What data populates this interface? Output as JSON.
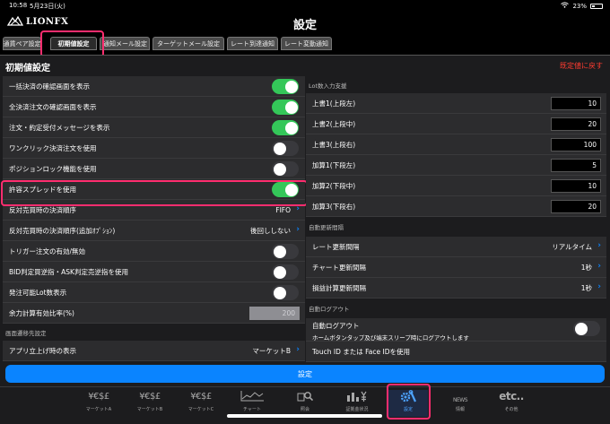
{
  "status_bar": {
    "time": "10:58",
    "date": "5月23日(火)",
    "battery": "23%"
  },
  "header": {
    "logo": "LIONFX",
    "title": "設定"
  },
  "tabs": [
    {
      "label": "通貨ペア設定",
      "active": false
    },
    {
      "label": "初期値設定",
      "active": true
    },
    {
      "label": "通知メール設定",
      "active": false
    },
    {
      "label": "ターゲットメール設定",
      "active": false
    },
    {
      "label": "レート到達通知",
      "active": false
    },
    {
      "label": "レート変動通知",
      "active": false
    }
  ],
  "section": {
    "title": "初期値設定",
    "reset": "既定値に戻す"
  },
  "left_rows": [
    {
      "label": "一括決済の確認画面を表示",
      "type": "toggle",
      "on": true
    },
    {
      "label": "全決済注文の確認画面を表示",
      "type": "toggle",
      "on": true
    },
    {
      "label": "注文・約定受付メッセージを表示",
      "type": "toggle",
      "on": true
    },
    {
      "label": "ワンクリック決済注文を使用",
      "type": "toggle",
      "on": false
    },
    {
      "label": "ポジションロック機能を使用",
      "type": "toggle",
      "on": false
    },
    {
      "label": "許容スプレッドを使用",
      "type": "toggle",
      "on": true
    },
    {
      "label": "反対売買時の決済順序",
      "type": "select",
      "value": "FIFO"
    },
    {
      "label": "反対売買時の決済順序(追加ｵﾌﾟｼｮﾝ)",
      "type": "select",
      "value": "後回ししない"
    },
    {
      "label": "トリガー注文の有効/無効",
      "type": "toggle",
      "on": false
    },
    {
      "label": "BID判定買逆指・ASK判定売逆指を使用",
      "type": "toggle",
      "on": false
    },
    {
      "label": "発注可能Lot数表示",
      "type": "toggle",
      "on": false
    },
    {
      "label": "余力計算有効比率(%)",
      "type": "number",
      "value": "200",
      "disabled": true
    }
  ],
  "left_group2": {
    "label": "画面遷移先設定",
    "rows": [
      {
        "label": "アプリ立上げ時の表示",
        "value": "マーケットB"
      }
    ]
  },
  "lot_group": {
    "label": "Lot数入力支援",
    "rows": [
      {
        "label": "上書1(上段左)",
        "value": "10"
      },
      {
        "label": "上書2(上段中)",
        "value": "20"
      },
      {
        "label": "上書3(上段右)",
        "value": "100"
      },
      {
        "label": "加算1(下段左)",
        "value": "5"
      },
      {
        "label": "加算2(下段中)",
        "value": "10"
      },
      {
        "label": "加算3(下段右)",
        "value": "20"
      }
    ]
  },
  "auto_update_group": {
    "label": "自動更新間隔",
    "rows": [
      {
        "label": "レート更新間隔",
        "value": "リアルタイム"
      },
      {
        "label": "チャート更新間隔",
        "value": "1秒"
      },
      {
        "label": "損益計算更新間隔",
        "value": "1秒"
      }
    ]
  },
  "auto_logout_group": {
    "label": "自動ログアウト",
    "row": {
      "label": "自動ログアウト",
      "sub": "ホームボタンタップ及び端末スリープ時にログアウトします"
    },
    "next_row": "Touch ID または Face IDを使用"
  },
  "submit_label": "設定",
  "nav": [
    {
      "glyph": "¥€$£",
      "label": "マーケットA"
    },
    {
      "glyph": "¥€$£",
      "label": "マーケットB"
    },
    {
      "glyph": "¥€$£",
      "label": "マーケットC"
    },
    {
      "glyph": "",
      "label": "チャート"
    },
    {
      "glyph": "",
      "label": "照会"
    },
    {
      "glyph": "",
      "label": "証拠金状況"
    },
    {
      "glyph": "",
      "label": "設定",
      "active": true
    },
    {
      "glyph": "NEWS",
      "label": "情報"
    },
    {
      "glyph": "etc..",
      "label": "その他"
    }
  ],
  "colors": {
    "toggle_on": "#34c759",
    "accent": "#0a84ff",
    "highlight": "#ff2d6f",
    "reset": "#ff3b30"
  }
}
